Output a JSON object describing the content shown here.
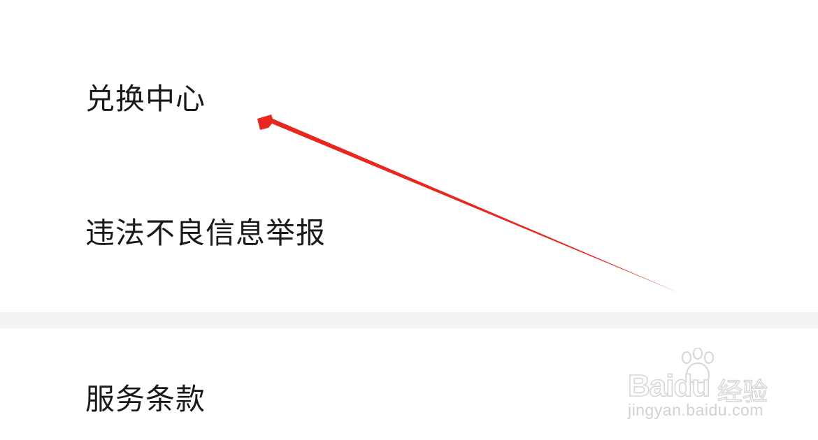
{
  "menu": {
    "group_1": [
      {
        "label": "兑换中心"
      },
      {
        "label": "违法不良信息举报"
      }
    ],
    "group_2": [
      {
        "label": "服务条款"
      }
    ]
  },
  "annotation": {
    "arrow_color": "#e8281e"
  },
  "watermark": {
    "brand": "Baidu",
    "cn": "经验",
    "url": "jingyan.baidu.com",
    "icon": "paw-icon"
  },
  "colors": {
    "background": "#ffffff",
    "separator": "#f3f3f3",
    "text": "#1a1a1a"
  }
}
